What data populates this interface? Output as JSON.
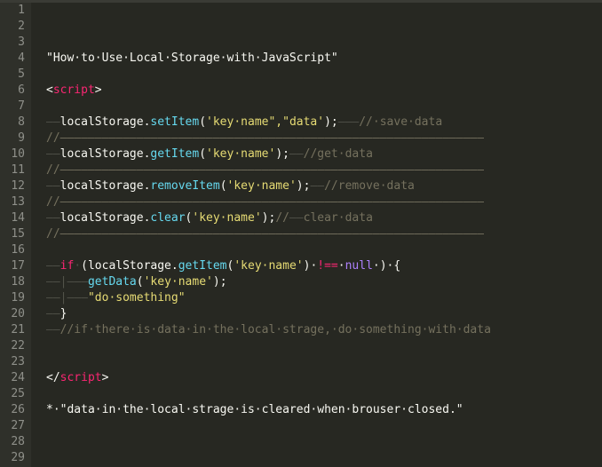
{
  "editor": {
    "lines": [
      {
        "n": "1",
        "segs": []
      },
      {
        "n": "2",
        "segs": []
      },
      {
        "n": "3",
        "segs": []
      },
      {
        "n": "4",
        "segs": [
          {
            "c": "t",
            "t": "\"How·to·Use·Local·Storage·with·JavaScript\""
          }
        ]
      },
      {
        "n": "5",
        "segs": []
      },
      {
        "n": "6",
        "segs": [
          {
            "c": "t",
            "t": "<"
          },
          {
            "c": "tag",
            "t": "script"
          },
          {
            "c": "t",
            "t": ">"
          }
        ]
      },
      {
        "n": "7",
        "segs": []
      },
      {
        "n": "8",
        "segs": [
          {
            "c": "ws",
            "t": "——"
          },
          {
            "c": "t",
            "t": "localStorage."
          },
          {
            "c": "fn",
            "t": "setItem"
          },
          {
            "c": "t",
            "t": "("
          },
          {
            "c": "str",
            "t": "'key·name\",\"data'"
          },
          {
            "c": "t",
            "t": ");"
          },
          {
            "c": "ws",
            "t": "———"
          },
          {
            "c": "cm",
            "t": "//·save·data"
          }
        ]
      },
      {
        "n": "9",
        "segs": [
          {
            "c": "cm",
            "t": "//—————————————————————————————————————————————————————————————"
          }
        ]
      },
      {
        "n": "10",
        "segs": [
          {
            "c": "ws",
            "t": "——"
          },
          {
            "c": "t",
            "t": "localStorage."
          },
          {
            "c": "fn",
            "t": "getItem"
          },
          {
            "c": "t",
            "t": "("
          },
          {
            "c": "str",
            "t": "'key·name'"
          },
          {
            "c": "t",
            "t": ");"
          },
          {
            "c": "ws",
            "t": "——"
          },
          {
            "c": "cm",
            "t": "//get·data"
          }
        ]
      },
      {
        "n": "11",
        "segs": [
          {
            "c": "cm",
            "t": "//—————————————————————————————————————————————————————————————"
          }
        ]
      },
      {
        "n": "12",
        "segs": [
          {
            "c": "ws",
            "t": "——"
          },
          {
            "c": "t",
            "t": "localStorage."
          },
          {
            "c": "fn",
            "t": "removeItem"
          },
          {
            "c": "t",
            "t": "("
          },
          {
            "c": "str",
            "t": "'key·name'"
          },
          {
            "c": "t",
            "t": ");"
          },
          {
            "c": "ws",
            "t": "——"
          },
          {
            "c": "cm",
            "t": "//remove·data"
          }
        ]
      },
      {
        "n": "13",
        "segs": [
          {
            "c": "cm",
            "t": "//—————————————————————————————————————————————————————————————"
          }
        ]
      },
      {
        "n": "14",
        "segs": [
          {
            "c": "ws",
            "t": "——"
          },
          {
            "c": "t",
            "t": "localStorage."
          },
          {
            "c": "fn",
            "t": "clear"
          },
          {
            "c": "t",
            "t": "("
          },
          {
            "c": "str",
            "t": "'key·name'"
          },
          {
            "c": "t",
            "t": ");"
          },
          {
            "c": "cm",
            "t": "//"
          },
          {
            "c": "ws",
            "t": "——"
          },
          {
            "c": "cm",
            "t": "clear·data"
          }
        ]
      },
      {
        "n": "15",
        "segs": [
          {
            "c": "cm",
            "t": "//—————————————————————————————————————————————————————————————"
          }
        ]
      },
      {
        "n": "16",
        "segs": []
      },
      {
        "n": "17",
        "segs": [
          {
            "c": "ws",
            "t": "——"
          },
          {
            "c": "kw",
            "t": "if"
          },
          {
            "c": "ws",
            "t": "·"
          },
          {
            "c": "t",
            "t": "(localStorage."
          },
          {
            "c": "fn",
            "t": "getItem"
          },
          {
            "c": "t",
            "t": "("
          },
          {
            "c": "str",
            "t": "'key·name'"
          },
          {
            "c": "t",
            "t": ")·"
          },
          {
            "c": "kw",
            "t": "!=="
          },
          {
            "c": "t",
            "t": "·"
          },
          {
            "c": "num",
            "t": "null"
          },
          {
            "c": "t",
            "t": "·)·{"
          }
        ]
      },
      {
        "n": "18",
        "segs": [
          {
            "c": "ws",
            "t": "——|———"
          },
          {
            "c": "fn",
            "t": "getData"
          },
          {
            "c": "t",
            "t": "("
          },
          {
            "c": "str",
            "t": "'key·name'"
          },
          {
            "c": "t",
            "t": ");"
          }
        ]
      },
      {
        "n": "19",
        "segs": [
          {
            "c": "ws",
            "t": "——|———"
          },
          {
            "c": "str",
            "t": "\"do·something\""
          }
        ]
      },
      {
        "n": "20",
        "segs": [
          {
            "c": "ws",
            "t": "——"
          },
          {
            "c": "t",
            "t": "}"
          }
        ]
      },
      {
        "n": "21",
        "segs": [
          {
            "c": "ws",
            "t": "——"
          },
          {
            "c": "cm",
            "t": "//if·there·is·data·in·the·local·strage,·do·something·with·data"
          }
        ]
      },
      {
        "n": "22",
        "segs": []
      },
      {
        "n": "23",
        "segs": []
      },
      {
        "n": "24",
        "segs": [
          {
            "c": "t",
            "t": "</"
          },
          {
            "c": "tag",
            "t": "script"
          },
          {
            "c": "t",
            "t": ">"
          }
        ]
      },
      {
        "n": "25",
        "segs": []
      },
      {
        "n": "26",
        "segs": [
          {
            "c": "t",
            "t": "*·\"data·in·the·local·strage·is·cleared·when·brouser·closed.\""
          }
        ]
      },
      {
        "n": "27",
        "segs": []
      },
      {
        "n": "28",
        "segs": []
      },
      {
        "n": "29",
        "segs": []
      }
    ]
  },
  "colors": {
    "background": "#272822",
    "text": "#f8f8f2",
    "comment": "#75715e",
    "function": "#66d9ef",
    "string": "#e6db74",
    "tag": "#f92672",
    "constant": "#ae81ff"
  }
}
